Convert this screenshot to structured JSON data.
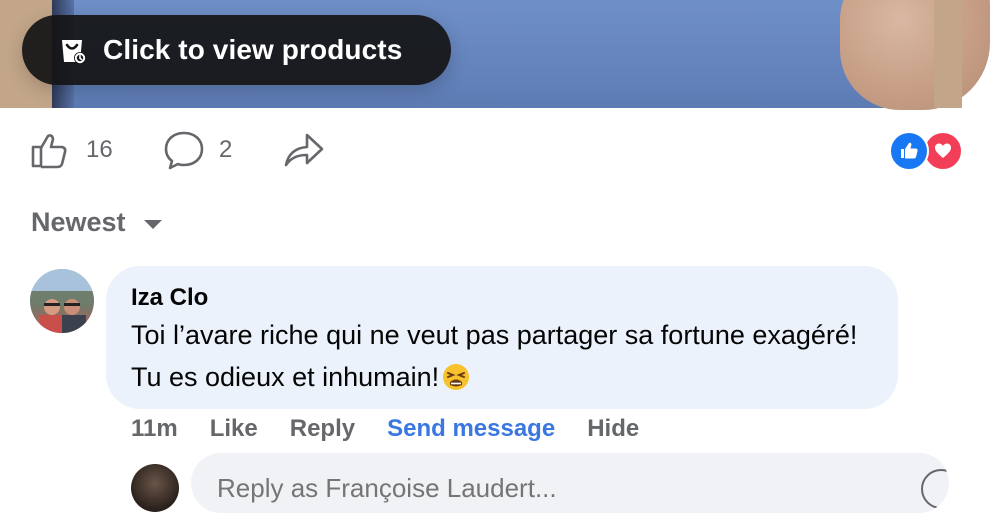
{
  "media": {
    "products_button_label": "Click to view products",
    "products_icon": "shopping-bag-icon"
  },
  "actions": {
    "like_count": "16",
    "comment_count": "2",
    "like_icon": "thumbs-up-icon",
    "comment_icon": "comment-icon",
    "share_icon": "share-icon",
    "reactions": [
      "like-reaction-icon",
      "love-reaction-icon"
    ],
    "like_reaction_color": "#1877f2",
    "love_reaction_color": "#f33e58"
  },
  "sort": {
    "label": "Newest"
  },
  "comment": {
    "author": "Iza Clo",
    "text": "Toi l’avare riche qui ne veut pas partager sa fortune exagéré! Tu es odieux et inhumain!",
    "emoji": "😫",
    "time": "11m",
    "like_label": "Like",
    "reply_label": "Reply",
    "send_message_label": "Send message",
    "hide_label": "Hide"
  },
  "reply": {
    "placeholder": "Reply as Françoise Laudert..."
  },
  "colors": {
    "accent_link": "#3a77e0",
    "muted_text": "#65676b",
    "bubble_bg": "#ebf2fb"
  }
}
